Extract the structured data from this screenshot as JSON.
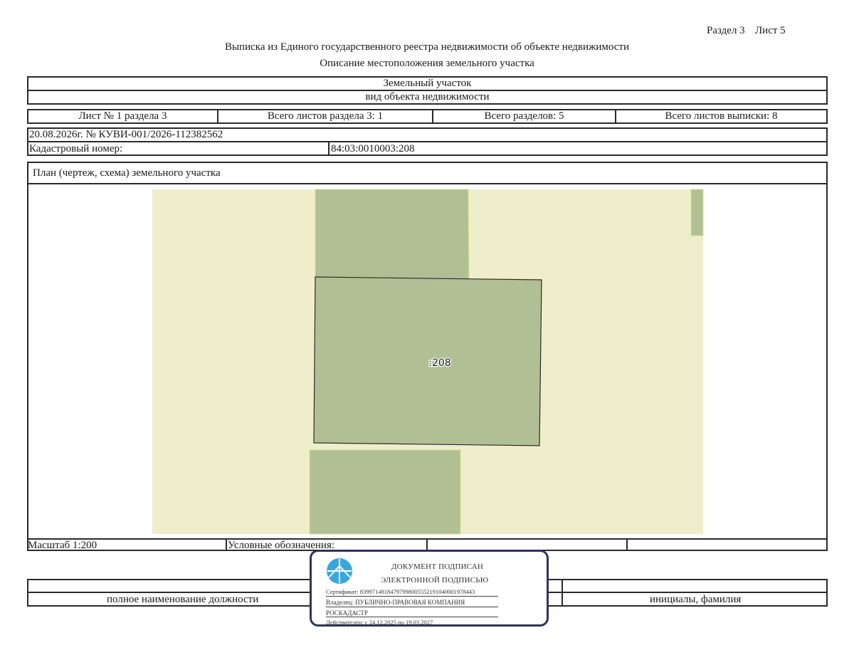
{
  "header": {
    "section": "Раздел 3",
    "sheet": "Лист 5",
    "title": "Выписка из Единого государственного реестра недвижимости об объекте недвижимости",
    "subtitle": "Описание местоположения земельного участка"
  },
  "object": {
    "type": "Земельный участок",
    "type_caption": "вид объекта недвижимости"
  },
  "sheet_info": {
    "sheet_no": "Лист № 1 раздела 3",
    "total_sheets_section": "Всего листов раздела 3: 1",
    "total_sections": "Всего разделов: 5",
    "total_sheets_extract": "Всего листов выписки: 8"
  },
  "record": {
    "date_number": "20.08.2026г. № КУВИ-001/2026-112382562",
    "cadastral_label": "Кадастровый номер:",
    "cadastral_value": "84:03:0010003:208"
  },
  "plan": {
    "title": "План (чертеж, схема) земельного участка",
    "parcel_label": ":208",
    "colors": {
      "background": "#eeeecb",
      "parcel": "#b1c094",
      "outline": "#2b2b2b"
    }
  },
  "footer": {
    "scale": "Масштаб 1:200",
    "legend": "Условные обозначения:",
    "position_caption": "полное наименование должности",
    "name_caption": "инициалы, фамилия"
  },
  "signature": {
    "line1": "ДОКУМЕНТ ПОДПИСАН",
    "line2": "ЭЛЕКТРОННОЙ ПОДПИСЬЮ",
    "certificate": "Сертификат: 83997148184797998005552191040001978443",
    "owner_line1": "Владелец: ПУБЛИЧНО-ПРАВОВАЯ КОМПАНИЯ",
    "owner_line2": "РОСКАДАСТР",
    "validity": "Действителен: с 24.12.2025 по 19.03.2027",
    "icon": "roskadastr-emblem-icon",
    "colors": {
      "frame": "#2e3559",
      "emblem": "#3aa6dd"
    }
  }
}
